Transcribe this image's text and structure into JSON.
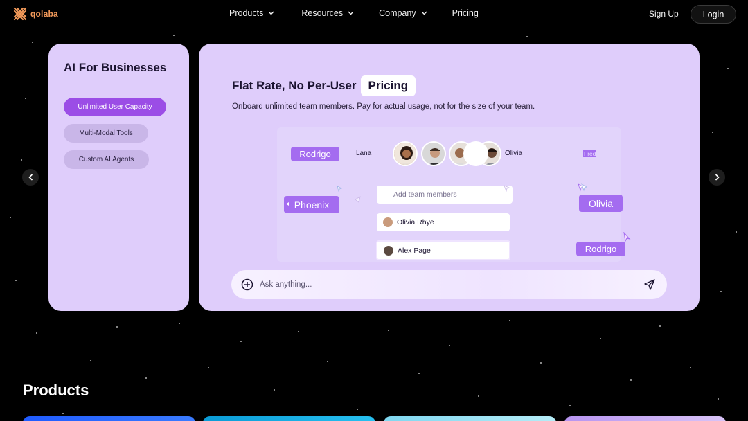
{
  "brand": {
    "name": "qolaba"
  },
  "nav": {
    "links": [
      {
        "label": "Products",
        "has_dropdown": true
      },
      {
        "label": "Resources",
        "has_dropdown": true
      },
      {
        "label": "Company",
        "has_dropdown": true
      },
      {
        "label": "Pricing",
        "has_dropdown": false
      }
    ],
    "signup_label": "Sign Up",
    "login_label": "Login"
  },
  "sidebar": {
    "title": "AI For Businesses",
    "items": [
      {
        "label": "Unlimited User Capacity",
        "active": true
      },
      {
        "label": "Multi-Modal Tools",
        "active": false
      },
      {
        "label": "Custom AI Agents",
        "active": false
      }
    ]
  },
  "feature": {
    "headline": "Flat Rate, No Per-User",
    "headline_chip": "Pricing",
    "subtitle": "Onboard unlimited team members. Pay for actual usage, not for the size of your team.",
    "collaborators": {
      "tag_rodrigo_top": "Rodrigo",
      "name_lana": "Lana",
      "name_olivia_inline": "Olivia",
      "name_fred": "Fred",
      "tag_phoenix": "Phoenix",
      "tag_olivia_right": "Olivia",
      "tag_rodrigo_bottom": "Rodrigo"
    },
    "add_members_placeholder": "Add team members",
    "members": [
      {
        "name": "Olivia Rhye"
      },
      {
        "name": "Alex Page"
      }
    ],
    "ask_placeholder": "Ask anything..."
  },
  "products": {
    "heading": "Products"
  },
  "colors": {
    "background": "#000000",
    "card": "#dfcdfb",
    "accent": "#9b4de6",
    "tag_purple": "#a46cf0",
    "brand_orange": "#f39a5a"
  }
}
